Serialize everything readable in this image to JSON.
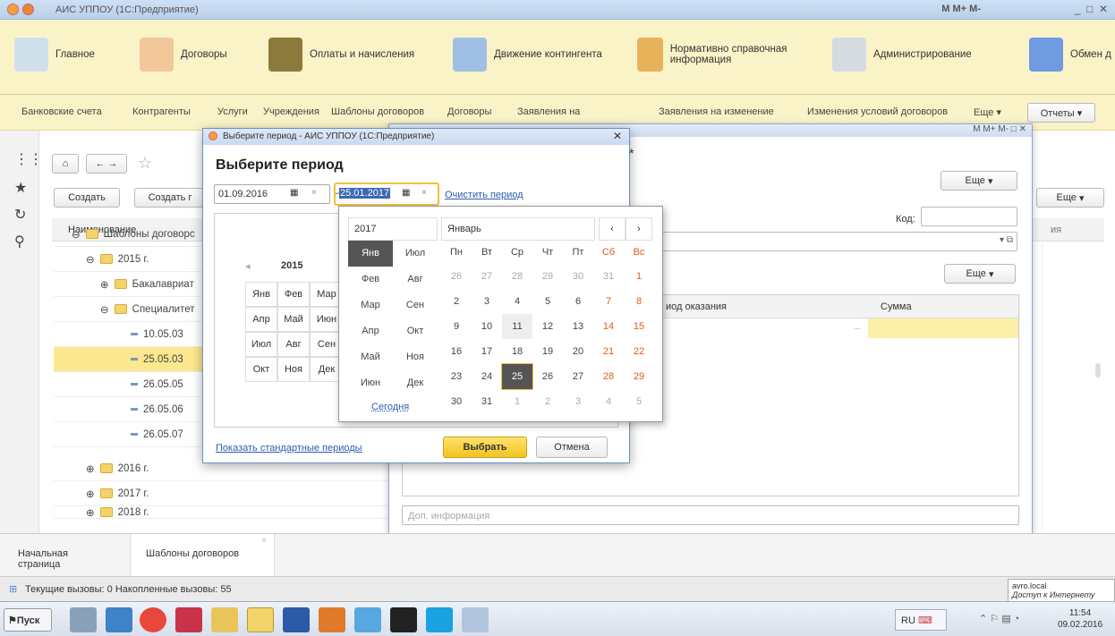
{
  "window": {
    "title": "АИС УППОУ (1С:Предприятие)",
    "tb_buttons": "M  M+  M-"
  },
  "sections": [
    "Главное",
    "Договоры",
    "Оплаты и начисления",
    "Движение контингента",
    "Нормативно справочная информация",
    "Администрирование",
    "Обмен д"
  ],
  "subnav": [
    "Банковские счета",
    "Контрагенты",
    "Услуги",
    "Учреждения",
    "Шаблоны договоров",
    "Договоры",
    "Заявления на",
    "Заявления на изменение",
    "Изменения условий договоров",
    "Еще ▾",
    "Отчеты ▾"
  ],
  "main": {
    "create": "Создать",
    "create_from": "Создать г",
    "more": "Еще",
    "col_name": "Наименование",
    "col_right": "ия"
  },
  "tree": [
    {
      "label": "Шаблоны договорc",
      "kind": "folder",
      "level": 0
    },
    {
      "label": "2015 г.",
      "kind": "folder",
      "level": 1
    },
    {
      "label": "Бакалавриат",
      "kind": "folder",
      "level": 2
    },
    {
      "label": "Специалитет",
      "kind": "folder",
      "level": 2
    },
    {
      "label": "10.05.03",
      "kind": "item",
      "level": 3
    },
    {
      "label": "25.05.03",
      "kind": "item",
      "level": 3,
      "selected": true
    },
    {
      "label": "26.05.05",
      "kind": "item",
      "level": 3
    },
    {
      "label": "26.05.06",
      "kind": "item",
      "level": 3
    },
    {
      "label": "26.05.07",
      "kind": "item",
      "level": 3
    },
    {
      "label": "2016 г.",
      "kind": "folder",
      "level": 1
    },
    {
      "label": "2017 г.",
      "kind": "folder",
      "level": 1
    },
    {
      "label": "2018 г.",
      "kind": "folder",
      "level": 1
    }
  ],
  "contract": {
    "more": "Еще",
    "code_label": "Код:",
    "more2": "Еще",
    "col_period": "иод оказания",
    "col_sum": "Сумма",
    "extra_placeholder": "Доп. информация",
    "star": "*"
  },
  "dialog": {
    "title": "Выберите период - АИС УППОУ (1С:Предприятие)",
    "heading": "Выберите период",
    "date_from": "01.09.2016",
    "date_to": "25.01.2017",
    "dash": "–",
    "clear": "Очистить период",
    "year_label": "2015",
    "months": [
      "Янв",
      "Фев",
      "Мар",
      "Апр",
      "Май",
      "Июн",
      "Июл",
      "Авг",
      "Сен",
      "Окт",
      "Ноя",
      "Дек"
    ],
    "std_periods": "Показать стандартные периоды",
    "ok": "Выбрать",
    "cancel": "Отмена"
  },
  "calendar": {
    "year": "2017",
    "month": "Январь",
    "months_col1": [
      "Янв",
      "Фев",
      "Мар",
      "Апр",
      "Май",
      "Июн"
    ],
    "months_col2": [
      "Июл",
      "Авг",
      "Сен",
      "Окт",
      "Ноя",
      "Дек"
    ],
    "today": "Сегодня",
    "weekdays": [
      "Пн",
      "Вт",
      "Ср",
      "Чт",
      "Пт",
      "Сб",
      "Вс"
    ],
    "weeks": [
      [
        "26",
        "27",
        "28",
        "29",
        "30",
        "31",
        "1"
      ],
      [
        "2",
        "3",
        "4",
        "5",
        "6",
        "7",
        "8"
      ],
      [
        "9",
        "10",
        "11",
        "12",
        "13",
        "14",
        "15"
      ],
      [
        "16",
        "17",
        "18",
        "19",
        "20",
        "21",
        "22"
      ],
      [
        "23",
        "24",
        "25",
        "26",
        "27",
        "28",
        "29"
      ],
      [
        "30",
        "31",
        "1",
        "2",
        "3",
        "4",
        "5"
      ]
    ],
    "selected_day": "25",
    "prev": "‹",
    "next": "›"
  },
  "tabs": [
    "Начальная страница",
    "Шаблоны договоров"
  ],
  "status": "Текущие вызовы: 0  Накопленные вызовы: 55",
  "network": {
    "host": "avro.local",
    "state": "Доступ к Интернету"
  },
  "taskbar": {
    "start": "Пуск",
    "lang": "RU",
    "time": "11:54",
    "date": "09.02.2016"
  }
}
